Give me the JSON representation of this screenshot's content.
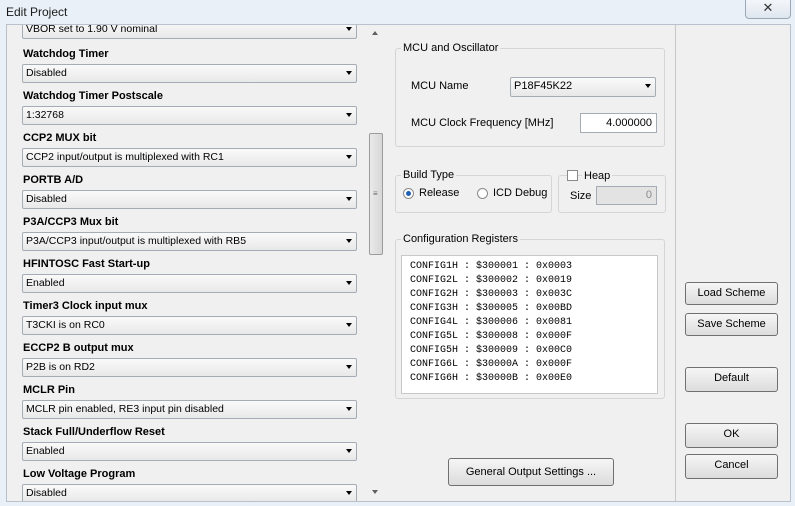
{
  "window": {
    "title": "Edit Project",
    "close_label": "✕"
  },
  "options": [
    {
      "label": "",
      "value": "VBOR set to 1.90 V nominal"
    },
    {
      "label": "Watchdog Timer",
      "value": "Disabled"
    },
    {
      "label": "Watchdog Timer Postscale",
      "value": "1:32768"
    },
    {
      "label": "CCP2 MUX bit",
      "value": "CCP2 input/output is multiplexed with RC1"
    },
    {
      "label": "PORTB A/D",
      "value": "Disabled"
    },
    {
      "label": "P3A/CCP3 Mux bit",
      "value": "P3A/CCP3 input/output is multiplexed with RB5"
    },
    {
      "label": "HFINTOSC Fast Start-up",
      "value": "Enabled"
    },
    {
      "label": "Timer3 Clock input mux",
      "value": "T3CKI is on RC0"
    },
    {
      "label": "ECCP2 B output mux",
      "value": "P2B is on RD2"
    },
    {
      "label": "MCLR Pin",
      "value": "MCLR pin enabled, RE3 input pin disabled"
    },
    {
      "label": "Stack Full/Underflow Reset",
      "value": "Enabled"
    },
    {
      "label": "Low Voltage Program",
      "value": "Disabled"
    }
  ],
  "mcu": {
    "group_title": "MCU and Oscillator",
    "name_label": "MCU Name",
    "name_value": "P18F45K22",
    "freq_label": "MCU Clock Frequency [MHz]",
    "freq_value": "4.000000"
  },
  "build": {
    "group_title": "Build Type",
    "release_label": "Release",
    "debug_label": "ICD Debug",
    "selected": "Release"
  },
  "heap": {
    "label": "Heap",
    "checked": false,
    "size_label": "Size",
    "size_value": "0"
  },
  "config": {
    "group_title": "Configuration Registers",
    "lines": [
      "CONFIG1H : $300001 : 0x0003",
      "CONFIG2L : $300002 : 0x0019",
      "CONFIG2H : $300003 : 0x003C",
      "CONFIG3H : $300005 : 0x00BD",
      "CONFIG4L : $300006 : 0x0081",
      "CONFIG5L : $300008 : 0x000F",
      "CONFIG5H : $300009 : 0x00C0",
      "CONFIG6L : $30000A : 0x000F",
      "CONFIG6H : $30000B : 0x00E0"
    ]
  },
  "buttons": {
    "general_output": "General Output Settings ...",
    "load_scheme": "Load Scheme",
    "save_scheme": "Save Scheme",
    "default": "Default",
    "ok": "OK",
    "cancel": "Cancel"
  }
}
